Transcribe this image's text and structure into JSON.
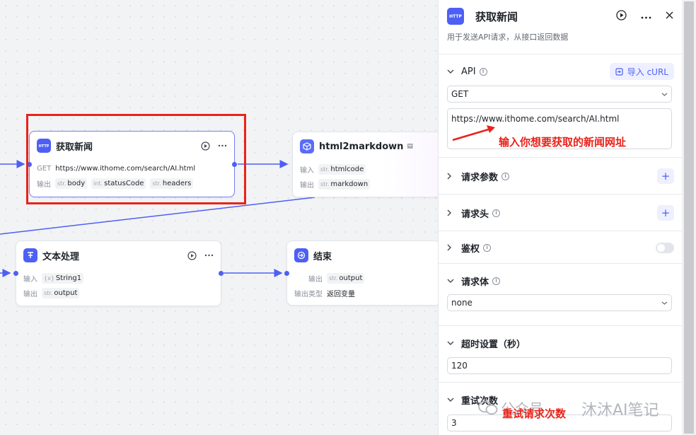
{
  "nodes": {
    "fetch": {
      "title": "获取新闻",
      "method_label": "GET",
      "url": "https://www.ithome.com/search/AI.html",
      "output_label": "输出",
      "outputs": [
        {
          "type": "str.",
          "name": "body"
        },
        {
          "type": "int.",
          "name": "statusCode"
        },
        {
          "type": "str.",
          "name": "headers"
        }
      ]
    },
    "h2m": {
      "title": "html2markdown",
      "input_label": "输入",
      "output_label": "输出",
      "input": {
        "type": "str.",
        "name": "htmlcode"
      },
      "output": {
        "type": "str.",
        "name": "markdown"
      }
    },
    "text": {
      "title": "文本处理",
      "input_label": "输入",
      "output_label": "输出",
      "input": {
        "type": "{x}",
        "name": "String1"
      },
      "output": {
        "type": "str.",
        "name": "output"
      }
    },
    "end": {
      "title": "结束",
      "output_label": "输出",
      "output": {
        "type": "str.",
        "name": "output"
      },
      "output_type_label": "输出类型",
      "output_type_value": "返回变量"
    }
  },
  "panel": {
    "title": "获取新闻",
    "description": "用于发送API请求，从接口返回数据",
    "api_label": "API",
    "import_label": "导入 cURL",
    "method": "GET",
    "url": "https://www.ithome.com/search/AI.html",
    "sections": {
      "params": "请求参数",
      "headers": "请求头",
      "auth": "鉴权",
      "body": "请求体",
      "timeout": "超时设置（秒）",
      "retry": "重试次数"
    },
    "body_value": "none",
    "timeout_value": "120",
    "retry_value": "3"
  },
  "annotations": {
    "url_note": "输入你想要获取的新闻网址",
    "retry_note": "重试请求次数"
  },
  "watermark": {
    "left": "公众号",
    "right": "沐沐AI笔记"
  },
  "colors": {
    "accent": "#4e5ff5",
    "annotation_red": "#e8231a"
  },
  "icons": [
    "http-icon",
    "play-icon",
    "more-icon",
    "close-icon",
    "cube-icon",
    "text-icon",
    "end-icon",
    "info-icon",
    "chevron-icon",
    "import-icon"
  ]
}
